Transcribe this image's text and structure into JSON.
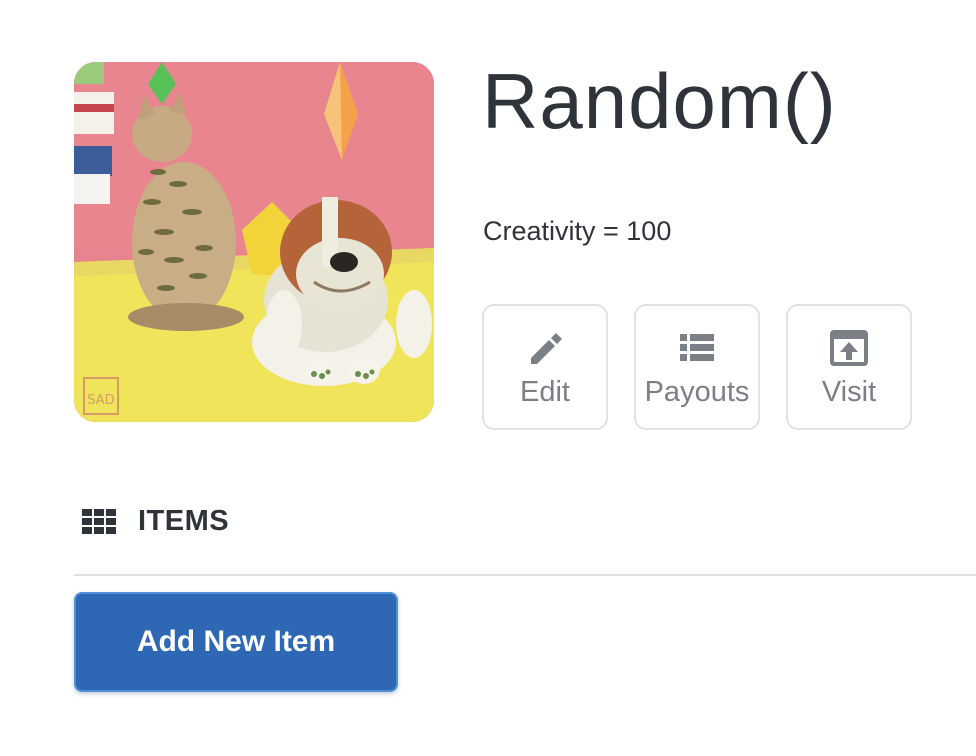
{
  "store": {
    "title": "Random()",
    "description": "Creativity = 100",
    "image_watermark": "SAD"
  },
  "actions": {
    "edit": {
      "label": "Edit",
      "icon": "pencil-icon"
    },
    "payouts": {
      "label": "Payouts",
      "icon": "list-icon"
    },
    "visit": {
      "label": "Visit",
      "icon": "open-external-icon"
    }
  },
  "items_section": {
    "title": "ITEMS",
    "icon": "grid-icon",
    "add_button_label": "Add New Item"
  },
  "colors": {
    "primary": "#2e68b5",
    "text": "#2f333a",
    "muted": "#7b7f86",
    "border": "#e2e2e5"
  }
}
